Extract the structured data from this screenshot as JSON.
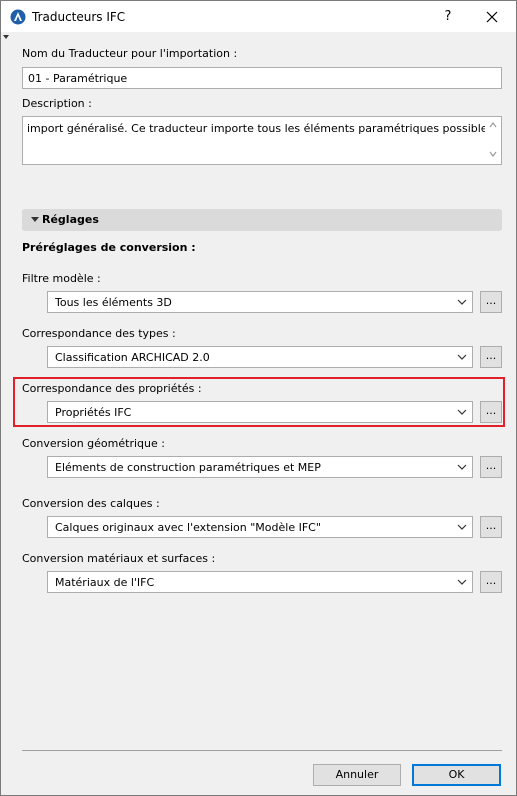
{
  "window": {
    "title": "Traducteurs IFC",
    "help_label": "?"
  },
  "importer": {
    "name_label": "Nom du Traducteur pour l'importation :",
    "name_value": "01 - Paramétrique",
    "description_label": "Description :",
    "description_value": "import généralisé. Ce traducteur importe tous les éléments paramétriques possibles."
  },
  "settings": {
    "section_title": "Réglages",
    "presets_label": "Préréglages de conversion :",
    "browse_label": "...",
    "rows": [
      {
        "label": "Filtre modèle :",
        "value": "Tous les éléments 3D"
      },
      {
        "label": "Correspondance des types :",
        "value": "Classification ARCHICAD 2.0"
      },
      {
        "label": "Correspondance des propriétés :",
        "value": "Propriétés IFC"
      },
      {
        "label": "Conversion géométrique :",
        "value": "Eléments de construction paramétriques et MEP"
      },
      {
        "label": "Conversion des calques :",
        "value": "Calques originaux avec l'extension \"Modèle IFC\""
      },
      {
        "label": "Conversion matériaux et surfaces :",
        "value": "Matériaux de l'IFC"
      }
    ]
  },
  "footer": {
    "cancel_label": "Annuler",
    "ok_label": "OK"
  },
  "colors": {
    "highlight": "#e0202a",
    "accent": "#0078d7"
  }
}
